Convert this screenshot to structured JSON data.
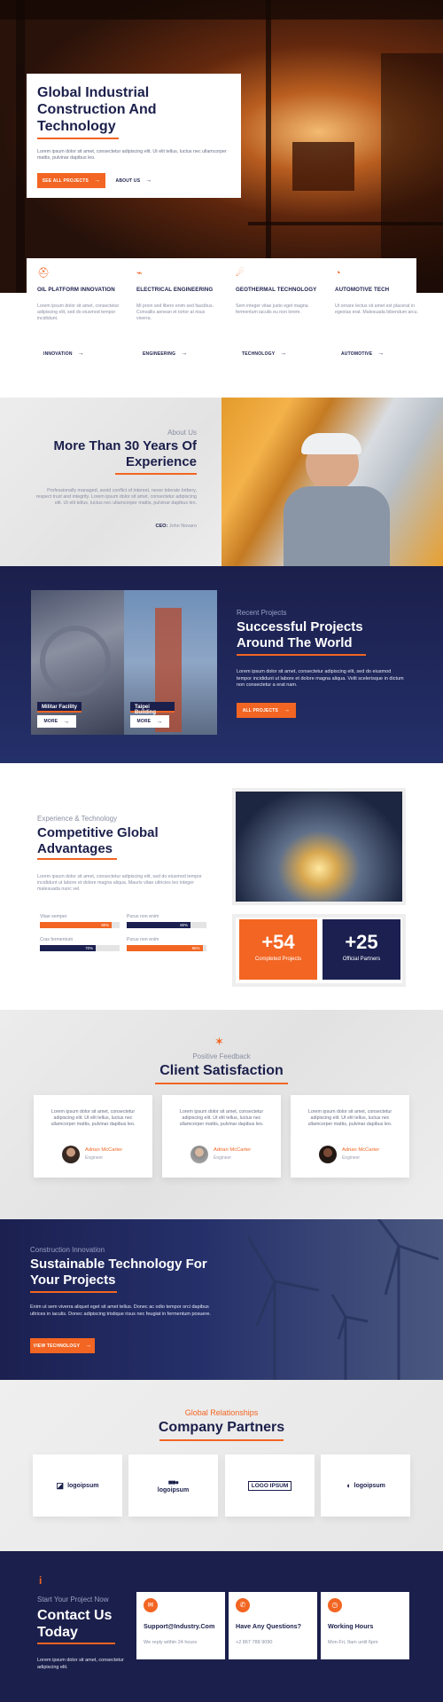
{
  "hero": {
    "title": "Global Industrial Construction And Technology",
    "text": "Lorem ipsum dolor sit amet, consectetur adipiscing elit. Ut elit tellus, luctus nec ullamcorper mattis, pulvinar dapibus leo.",
    "btn_projects": "SEE ALL PROJECTS",
    "btn_about": "ABOUT US"
  },
  "services": [
    {
      "icon": "helmet-icon",
      "title": "OIL PLATFORM INNOVATION",
      "text": "Lorem ipsum dolor sit amet, consectetur adipiscing elit, sed do eiusmod tempor incididunt.",
      "link": "INNOVATION"
    },
    {
      "icon": "plug-icon",
      "title": "ELECTRICAL ENGINEERING",
      "text": "Mi proin sed libero enim sed faucibus. Convallis aenean et tortor at risus viverra.",
      "link": "ENGINEERING"
    },
    {
      "icon": "drill-icon",
      "title": "GEOTHERMAL TECHNOLOGY",
      "text": "Sem integer vitae justo eget magna fermentum iaculis eu non lorem.",
      "link": "TECHNOLOGY"
    },
    {
      "icon": "gauge-icon",
      "title": "AUTOMOTIVE TECH",
      "text": "Ut ornare lectus sit amet est placerat in egestas erat. Malesuada bibendum arcu.",
      "link": "AUTOMOTIVE"
    }
  ],
  "about": {
    "kicker": "About Us",
    "title": "More Than 30 Years Of Experience",
    "text": "Professionally managed, avoid conflict of interest, never tolerate bribery, respect trust and integrity. Lorem ipsum dolor sit amet, consectetur adipiscing elit. Ut elit tellus, luctus nec ullamcorper mattis, pulvinar dapibus leo.",
    "author_role": "CEO:",
    "author_name": "John Novaro"
  },
  "projects": {
    "kicker": "Recent Projects",
    "title": "Successful Projects Around The World",
    "text": "Lorem ipsum dolor sit amet, consectetur adipiscing elit, sed do eiusmod tempor incididunt ut labore et dolore magna aliqua. Velit scelerisque in dictum non consectetur a erat nam.",
    "button": "ALL PROJECTS",
    "items": [
      {
        "label": "Militar Facility",
        "more": "MORE"
      },
      {
        "label": "Taipei Building",
        "more": "MORE"
      }
    ]
  },
  "advantages": {
    "kicker": "Experience & Technology",
    "title": "Competitive Global Advantages",
    "text": "Lorem ipsum dolor sit amet, consectetur adipiscing elit, sed do eiusmod tempor incididunt ut labore et dolore magna aliqua. Mauris vitae ultricies leo integer malesuada nunc vel.",
    "bars": [
      {
        "label": "Vitae semper",
        "value": 90,
        "display": "90%",
        "color": "#f26522"
      },
      {
        "label": "Purus non enim",
        "value": 80,
        "display": "80%",
        "color": "#1b2050"
      },
      {
        "label": "Cras fermentum",
        "value": 70,
        "display": "70%",
        "color": "#1b2050"
      },
      {
        "label": "Purus non enim",
        "value": 95,
        "display": "95%",
        "color": "#f26522"
      }
    ],
    "stats": [
      {
        "number": "+54",
        "label": "Completed Projects",
        "color": "#f26522"
      },
      {
        "number": "+25",
        "label": "Official Partners",
        "color": "#1b2050"
      }
    ]
  },
  "testimonials": {
    "kicker": "Positive Feedback",
    "title": "Client Satisfaction",
    "items": [
      {
        "text": "Lorem ipsum dolor sit amet, consectetur adipiscing elit. Ut elit tellus, luctus nec ullamcorper mattis, pulvinar dapibus leo.",
        "name": "Adrian McCarter",
        "role": "Engineer"
      },
      {
        "text": "Lorem ipsum dolor sit amet, consectetur adipiscing elit. Ut elit tellus, luctus nec ullamcorper mattis, pulvinar dapibus leo.",
        "name": "Adrian McCarter",
        "role": "Engineer"
      },
      {
        "text": "Lorem ipsum dolor sit amet, consectetur adipiscing elit. Ut elit tellus, luctus nec ullamcorper mattis, pulvinar dapibus leo.",
        "name": "Adrian McCarter",
        "role": "Engineer"
      }
    ]
  },
  "sustainable": {
    "kicker": "Construction Innovation",
    "title": "Sustainable Technology For Your Projects",
    "text": "Enim ut sem viverra aliquet eget sit amet tellus. Donec ac odio tempor orci dapibus ultrices in iaculis. Donec adipiscing tristique risus nec feugiat in fermentum posuere.",
    "button": "VIEW TECHNOLOGY"
  },
  "partners": {
    "kicker": "Global Relationships",
    "title": "Company Partners",
    "logos": [
      "logoipsum",
      "logoipsum",
      "LOGO IPSUM",
      "logoipsum"
    ]
  },
  "contact": {
    "kicker": "Start Your Project Now",
    "title": "Contact Us Today",
    "text": "Lorem ipsum dolor sit amet, consectetur adipiscing elit.",
    "cards": [
      {
        "icon": "mail-icon",
        "title": "Support@Industry.Com",
        "text": "We reply within 24 hours"
      },
      {
        "icon": "phone-icon",
        "title": "Have Any Questions?",
        "text": "+2 867 788 9090"
      },
      {
        "icon": "clock-icon",
        "title": "Working Hours",
        "text": "Mon-Fri, 9am until 6pm"
      }
    ]
  },
  "colors": {
    "accent": "#f26522",
    "navy": "#1b1f4b"
  }
}
